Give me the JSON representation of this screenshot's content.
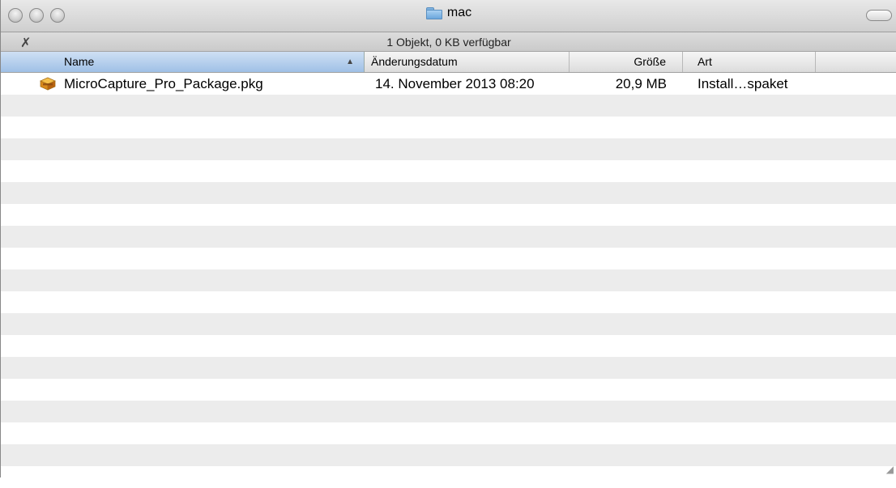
{
  "window": {
    "title": "mac",
    "folder_icon": "folder-icon"
  },
  "status": {
    "text": "1 Objekt, 0 KB verfügbar"
  },
  "columns": {
    "name": "Name",
    "date": "Änderungsdatum",
    "size": "Größe",
    "kind": "Art",
    "sort_indicator": "▲"
  },
  "files": [
    {
      "icon": "package-icon",
      "name": "MicroCapture_Pro_Package.pkg",
      "date": "14. November 2013 08:20",
      "size": "20,9 MB",
      "kind": "Install…spaket"
    }
  ],
  "colors": {
    "selected_header": "#a9c8ec",
    "stripe": "#ececec"
  }
}
